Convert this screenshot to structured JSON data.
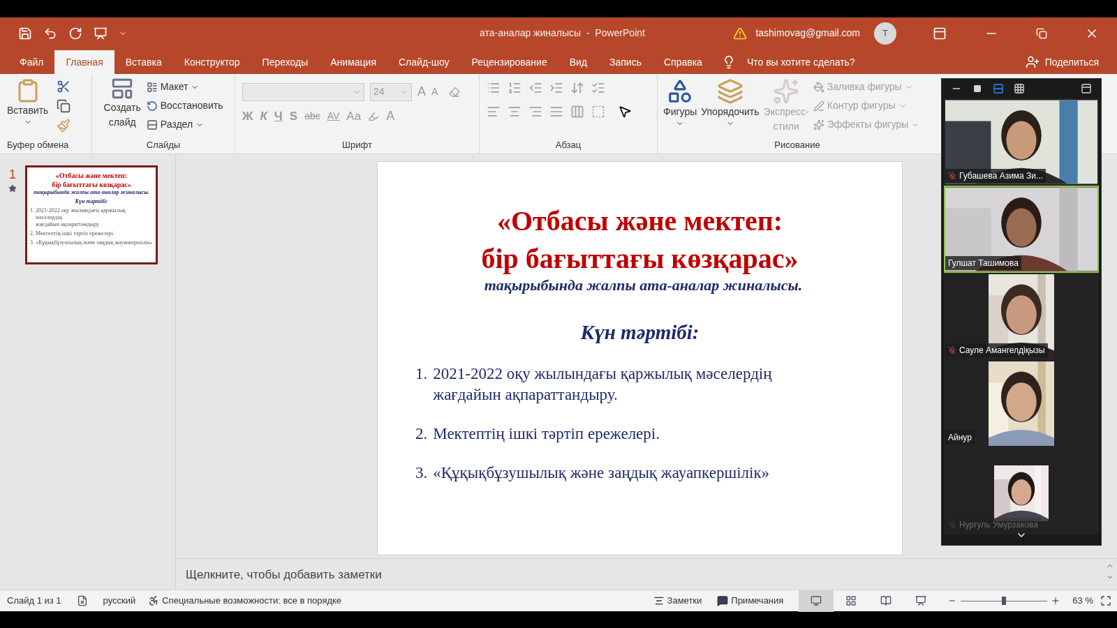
{
  "window": {
    "title": "ата-аналар жиналысы  -  PowerPoint",
    "account": "tashimovag@gmail.com",
    "avatar": "T"
  },
  "tabs": [
    {
      "label": "Файл",
      "selected": false
    },
    {
      "label": "Главная",
      "selected": true
    },
    {
      "label": "Вставка",
      "selected": false
    },
    {
      "label": "Конструктор",
      "selected": false
    },
    {
      "label": "Переходы",
      "selected": false
    },
    {
      "label": "Анимация",
      "selected": false
    },
    {
      "label": "Слайд-шоу",
      "selected": false
    },
    {
      "label": "Рецензирование",
      "selected": false
    },
    {
      "label": "Вид",
      "selected": false
    },
    {
      "label": "Запись",
      "selected": false
    },
    {
      "label": "Справка",
      "selected": false
    }
  ],
  "tell_me": {
    "placeholder": "Что вы хотите сделать?"
  },
  "share": "Поделиться",
  "ribbon": {
    "clipboard": {
      "paste": "Вставить",
      "label": "Буфер обмена"
    },
    "slides": {
      "new_slide": [
        "Создать",
        "слайд"
      ],
      "layout": "Макет",
      "reset": "Восстановить",
      "section": "Раздел",
      "label": "Слайды"
    },
    "font": {
      "size": "24",
      "grow": "A",
      "shrink": "A",
      "buttons": [
        {
          "kind": "bold",
          "text": "Ж"
        },
        {
          "kind": "italic",
          "text": "К"
        },
        {
          "kind": "underline",
          "text": "Ч"
        },
        {
          "kind": "shadow",
          "text": "S"
        },
        {
          "kind": "strike",
          "text": "abc"
        },
        {
          "kind": "spacing",
          "text": "AV"
        },
        {
          "kind": "case",
          "text": "Aa"
        }
      ],
      "font_color": "A",
      "label": "Шрифт"
    },
    "paragraph": {
      "label": "Абзац"
    },
    "drawing": {
      "shapes": "Фигуры",
      "arrange": "Упорядочить",
      "styles": [
        "Экспресс-",
        "стили"
      ],
      "options": [
        {
          "label": "Заливка фигуры",
          "disabled": true
        },
        {
          "label": "Контур фигуры",
          "disabled": true
        },
        {
          "label": "Эффекты фигуры",
          "disabled": true
        }
      ],
      "label": "Рисование"
    }
  },
  "thumbnail": {
    "number": "1",
    "selected": true,
    "slide": {
      "title": [
        "«Отбасы және мектеп:",
        "бір бағыттағы көзқарас»"
      ],
      "subtitle": "тақырыбында жалпы ата-аналар жиналысы.",
      "agenda": "Күн тәртібі:",
      "items": [
        {
          "number": "1.",
          "lines": [
            "2021-2022 оқу жылындағы қаржылық мәселердің",
            "жағдайын ақпараттандыру."
          ]
        },
        {
          "number": "2.",
          "lines": [
            "Мектептің ішкі тәртіп ережелері."
          ]
        },
        {
          "number": "3.",
          "lines": [
            "«Құқықбұзушылық және заңдық жауапкершілік»"
          ]
        }
      ]
    }
  },
  "slide": {
    "title": [
      "«Отбасы және мектеп:",
      "бір бағыттағы көзқарас»"
    ],
    "subtitle": "тақырыбында жалпы ата-аналар жиналысы.",
    "agenda": "Күн тәртібі:",
    "items": [
      {
        "number": "1.",
        "lines": [
          "2021-2022 оқу жылындағы қаржылық мәселердің",
          "жағдайын ақпараттандыру."
        ]
      },
      {
        "number": "2.",
        "lines": [
          "Мектептің ішкі тәртіп ережелері."
        ]
      },
      {
        "number": "3.",
        "lines": [
          "«Құқықбұзушылық және заңдық жауапкершілік»"
        ]
      }
    ]
  },
  "notes": {
    "placeholder": "Щелкните, чтобы добавить заметки"
  },
  "status_bar": {
    "slide": "Слайд 1 из 1",
    "language": "русский",
    "accessibility": "Специальные возможности: все в порядке",
    "notes": "Заметки",
    "comments": "Примечания",
    "views": [
      {
        "kind": "normal",
        "selected": true
      },
      {
        "kind": "sorter",
        "selected": false
      },
      {
        "kind": "reading",
        "selected": false
      },
      {
        "kind": "show",
        "selected": false
      }
    ],
    "zoom": {
      "level": 0.5,
      "reading": "63 %"
    }
  },
  "meeting": {
    "participants": [
      {
        "name": "Губашева Азима Зи...",
        "muted": true,
        "speaking": false,
        "kind": "wide"
      },
      {
        "name": "Гулшат Ташимова",
        "muted": false,
        "speaking": true,
        "kind": "wide"
      },
      {
        "name": "Сауле Амангелдіқызы",
        "muted": true,
        "speaking": false,
        "kind": "portrait"
      },
      {
        "name": "Айнур",
        "muted": false,
        "speaking": false,
        "kind": "portrait"
      },
      {
        "name": "Нургуль Умурзакова",
        "muted": true,
        "speaking": false,
        "kind": "portrait"
      }
    ]
  }
}
